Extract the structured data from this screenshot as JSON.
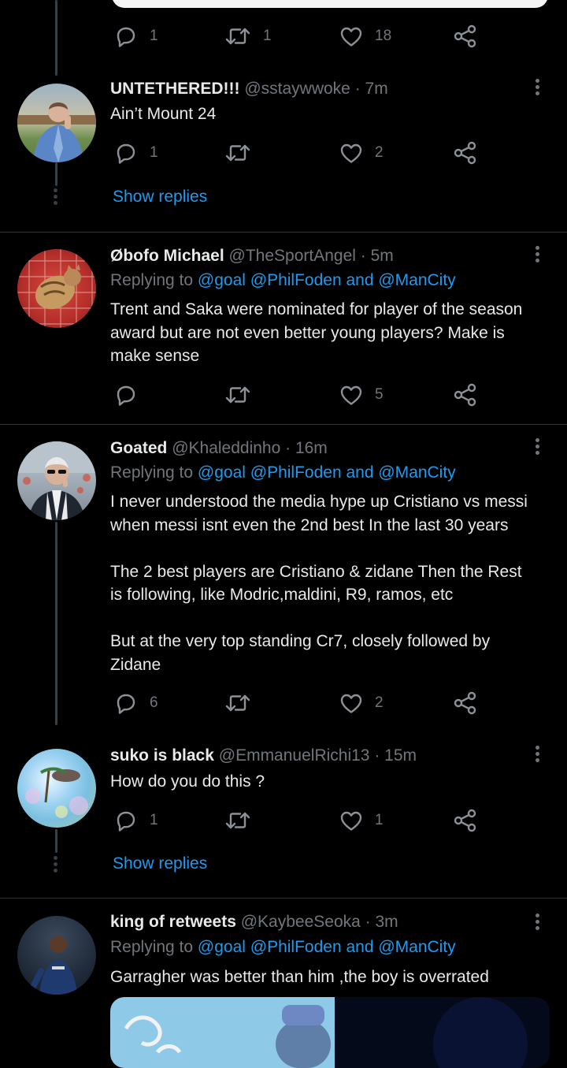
{
  "top_actions": {
    "replies": "1",
    "retweets": "1",
    "likes": "18"
  },
  "tweets": [
    {
      "name": "UNTETHERED!!!",
      "handle": "@sstaywwoke",
      "time": "· 7m",
      "text": "Ain’t Mount 24",
      "replies": "1",
      "retweets": "",
      "likes": "2",
      "show_replies": "Show replies"
    },
    {
      "name": "Øbofo Michael",
      "handle": "@TheSportAngel",
      "time": "· 5m",
      "replying_prefix": "Replying to",
      "replying_mentions": "@goal @PhilFoden and @ManCity",
      "text": "Trent and Saka were nominated for player of the season\naward but are not even better young players? Make is\nmake sense",
      "replies": "",
      "retweets": "",
      "likes": "5"
    },
    {
      "name": "Goated",
      "handle": "@Khaleddinho",
      "time": "· 16m",
      "replying_prefix": "Replying to",
      "replying_mentions": "@goal @PhilFoden and @ManCity",
      "text": "I never understood the media hype up Cristiano vs messi\nwhen messi isnt even the 2nd best In the last 30 years\n\nThe 2 best players are Cristiano & zidane Then the Rest\nis following, like Modric,maldini, R9, ramos, etc\n\nBut at the very top standing Cr7, closely followed by\nZidane",
      "replies": "6",
      "retweets": "",
      "likes": "2"
    },
    {
      "name": "suko is black",
      "handle": "@EmmanuelRichi13",
      "time": "· 15m",
      "text": "How do you do this ?",
      "replies": "1",
      "retweets": "",
      "likes": "1",
      "show_replies": "Show replies"
    },
    {
      "name": "king of retweets",
      "handle": "@KaybeeSeoka",
      "time": "· 3m",
      "replying_prefix": "Replying to",
      "replying_mentions": "@goal @PhilFoden and @ManCity",
      "text": "Garragher was better than him ,the boy is overrated"
    }
  ],
  "icons": {
    "reply": "reply-icon",
    "retweet": "retweet-icon",
    "like": "heart-icon",
    "share": "share-icon",
    "more": "more-icon"
  },
  "colors": {
    "background": "#000000",
    "text": "#e7e9ea",
    "muted": "#71767b",
    "link": "#1d9bf0",
    "divider": "#2f3336"
  }
}
